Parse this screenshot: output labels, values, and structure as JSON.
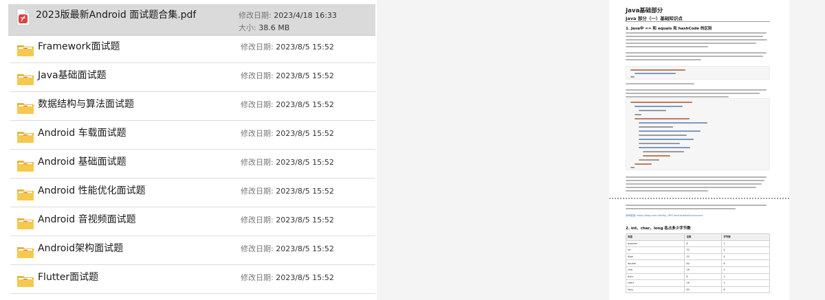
{
  "file_list": {
    "modified_label": "修改日期:",
    "size_label": "大小:",
    "items": [
      {
        "name": "2023版最新Android 面试题合集.pdf",
        "type": "pdf",
        "modified": "2023/4/18 16:33",
        "size": "38.6 MB",
        "selected": true
      },
      {
        "name": "Framework面试题",
        "type": "folder",
        "modified": "2023/8/5 15:52"
      },
      {
        "name": "Java基础面试题",
        "type": "folder",
        "modified": "2023/8/5 15:52"
      },
      {
        "name": "数据结构与算法面试题",
        "type": "folder",
        "modified": "2023/8/5 15:52"
      },
      {
        "name": "Android 车载面试题",
        "type": "folder",
        "modified": "2023/8/5 15:52"
      },
      {
        "name": "Android 基础面试题",
        "type": "folder",
        "modified": "2023/8/5 15:52"
      },
      {
        "name": "Android 性能优化面试题",
        "type": "folder",
        "modified": "2023/8/5 15:52"
      },
      {
        "name": "Android 音视频面试题",
        "type": "folder",
        "modified": "2023/8/5 15:52"
      },
      {
        "name": "Android架构面试题",
        "type": "folder",
        "modified": "2023/8/5 15:52"
      },
      {
        "name": "Flutter面试题",
        "type": "folder",
        "modified": "2023/8/5 15:52"
      }
    ]
  },
  "preview": {
    "title": "Java基础部分",
    "subtitle": "Java 部分（一）基础知识点",
    "section1": "1. Java中 == 和 equals 和 hashCode 的区别",
    "section2": "2. int、char、long 各占多少字节数",
    "link": "参考链接: https://blog.csdn.net/fsp_7657/article/details/xxxxxxxx",
    "table_header": [
      "类型",
      "位数",
      "字节数"
    ],
    "table_rows": [
      [
        "boolean",
        "8",
        "1"
      ],
      [
        "int",
        "32",
        "4"
      ],
      [
        "float",
        "32",
        "4"
      ],
      [
        "double",
        "64",
        "8"
      ],
      [
        "char",
        "16",
        "2"
      ],
      [
        "byte",
        "8",
        "1"
      ],
      [
        "short",
        "16",
        "2"
      ],
      [
        "long",
        "64",
        "8"
      ]
    ]
  },
  "colors": {
    "selected_row": "#dadada",
    "folder": "#f5c94d",
    "pdf": "#e04040",
    "link": "#3b6fb6"
  },
  "icons": {
    "pdf": "pdf-file-icon",
    "folder": "folder-icon"
  }
}
